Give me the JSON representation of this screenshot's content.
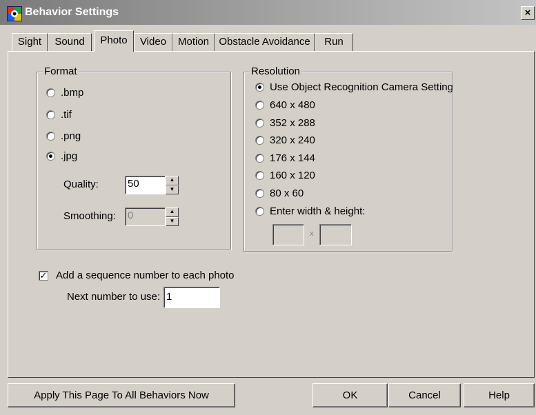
{
  "window": {
    "title": "Behavior Settings",
    "close_label": "×"
  },
  "tabs": [
    {
      "label": "Sight"
    },
    {
      "label": "Sound"
    },
    {
      "label": "Photo"
    },
    {
      "label": "Video"
    },
    {
      "label": "Motion"
    },
    {
      "label": "Obstacle Avoidance"
    },
    {
      "label": "Run"
    }
  ],
  "active_tab": "Photo",
  "format": {
    "title": "Format",
    "options": [
      {
        "label": ".bmp",
        "checked": false
      },
      {
        "label": ".tif",
        "checked": false
      },
      {
        "label": ".png",
        "checked": false
      },
      {
        "label": ".jpg",
        "checked": true
      }
    ],
    "quality_label": "Quality:",
    "quality_value": "50",
    "smoothing_label": "Smoothing:",
    "smoothing_value": "0"
  },
  "resolution": {
    "title": "Resolution",
    "options": [
      {
        "label": "Use Object Recognition Camera Setting",
        "checked": true
      },
      {
        "label": "640 x 480",
        "checked": false
      },
      {
        "label": "352 x 288",
        "checked": false
      },
      {
        "label": "320 x 240",
        "checked": false
      },
      {
        "label": "176 x 144",
        "checked": false
      },
      {
        "label": "160 x 120",
        "checked": false
      },
      {
        "label": "80 x 60",
        "checked": false
      },
      {
        "label": "Enter width & height:",
        "checked": false
      }
    ],
    "width_value": "",
    "height_value": "",
    "times_label": "x"
  },
  "sequence": {
    "checkbox_label": "Add a sequence number to each photo",
    "checked": true,
    "check_mark": "✓",
    "next_label": "Next number to use:",
    "next_value": "1"
  },
  "buttons": {
    "apply_all": "Apply This Page To All Behaviors Now",
    "ok": "OK",
    "cancel": "Cancel",
    "help": "Help"
  },
  "colors": {
    "dialog_bg": "#d4d0c8",
    "title_text": "#ffffff"
  }
}
